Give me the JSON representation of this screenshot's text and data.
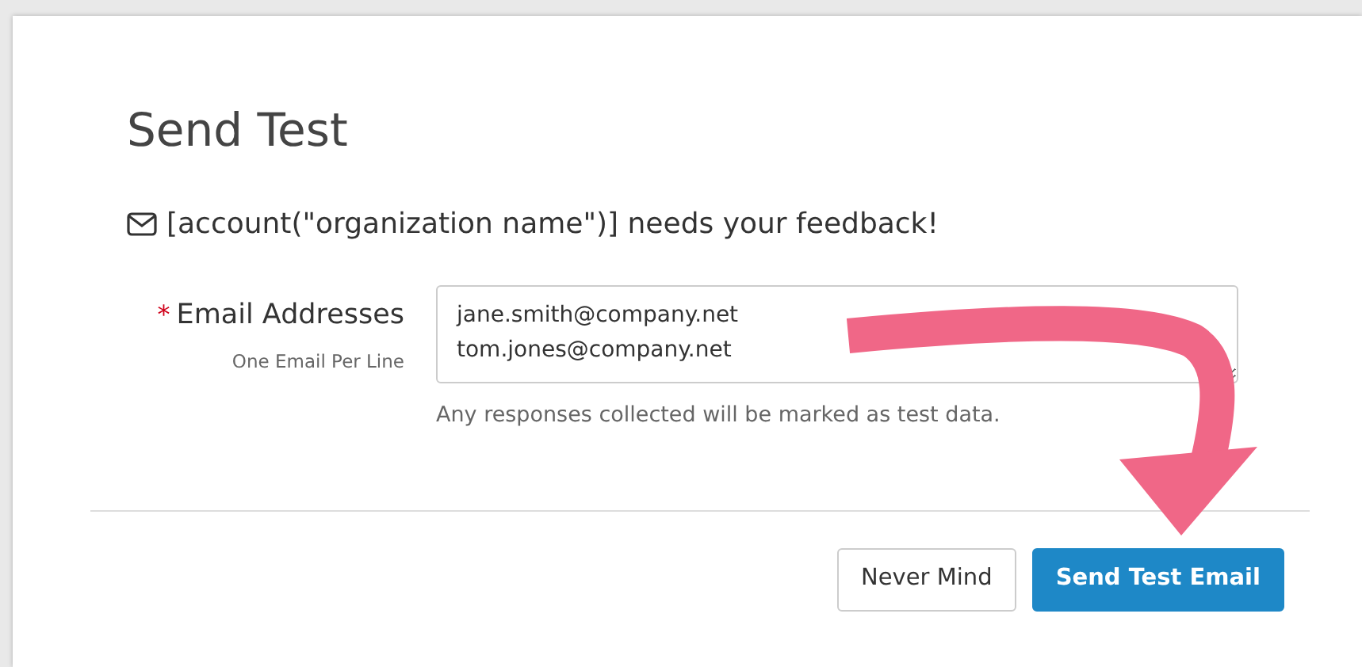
{
  "dialog": {
    "title": "Send Test",
    "subject": "[account(\"organization name\")] needs your feedback!"
  },
  "email_field": {
    "required_mark": "*",
    "label": "Email Addresses",
    "hint": "One Email Per Line",
    "value": [
      "jane.smith@company.net",
      "tom.jones@company.net"
    ],
    "help": "Any responses collected will be marked as test data."
  },
  "buttons": [
    {
      "label": "Never Mind",
      "kind": "secondary"
    },
    {
      "label": "Send Test Email",
      "kind": "primary"
    }
  ]
}
